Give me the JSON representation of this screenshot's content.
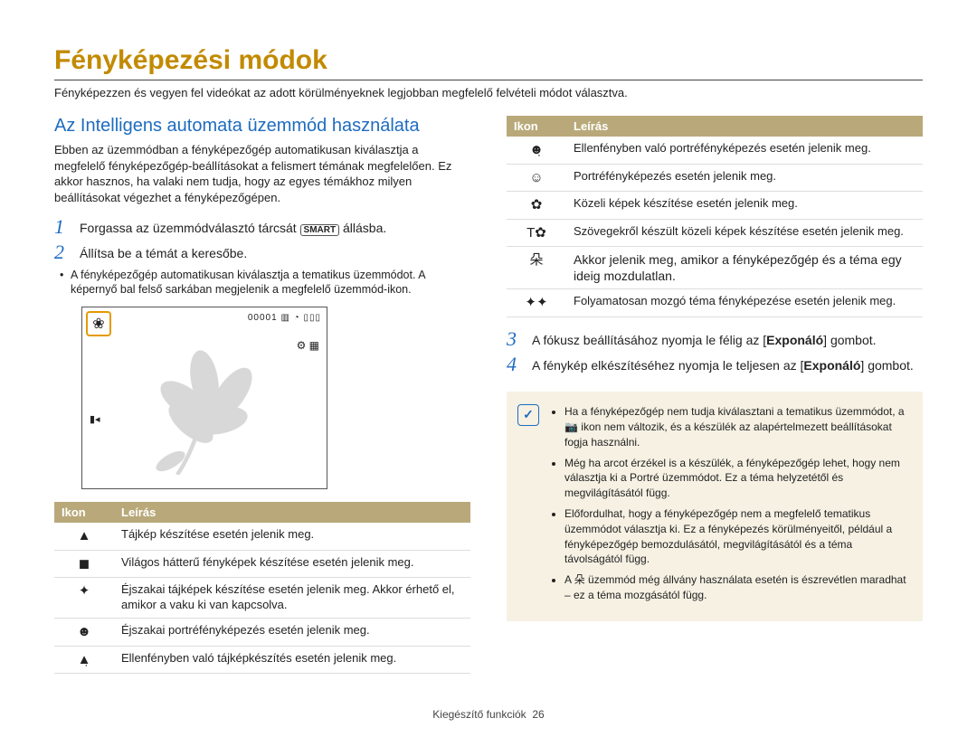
{
  "title": "Fényképezési módok",
  "subtitle": "Fényképezzen és vegyen fel videókat az adott körülményeknek legjobban megfelelő felvételi módot választva.",
  "section_heading": "Az Intelligens automata üzemmód használata",
  "intro": "Ebben az üzemmódban a fényképezőgép automatikusan kiválasztja a megfelelő fényképezőgép-beállításokat a felismert témának megfelelően. Ez akkor hasznos, ha valaki nem tudja, hogy az egyes témákhoz milyen beállításokat végezhet a fényképezőgépen.",
  "steps": {
    "1": {
      "pre": "Forgassa az üzemmódválasztó tárcsát ",
      "dial": "SMART",
      "post": " állásba."
    },
    "2": {
      "text": "Állítsa be a témát a keresőbe.",
      "bullet": "A fényképezőgép automatikusan kiválasztja a tematikus üzemmódot. A képernyő bal felső sarkában megjelenik a megfelelő üzemmód-ikon."
    },
    "3": {
      "pre": "A fókusz beállításához nyomja le félig az [",
      "bold": "Exponáló",
      "post": "] gombot."
    },
    "4": {
      "pre": "A fénykép elkészítéséhez nyomja le teljesen az [",
      "bold": "Exponáló",
      "post": "] gombot."
    }
  },
  "screenshot": {
    "badge_glyph": "❀",
    "counter": "00001",
    "top_glyphs": "▥ ◔ ▯▯▯",
    "right_glyphs": "⚙\n▦",
    "left_glyphs": "▮◂"
  },
  "table_headers": {
    "icon": "Ikon",
    "desc": "Leírás"
  },
  "left_table": [
    {
      "glyph": "▲",
      "desc": "Tájkép készítése esetén jelenik meg."
    },
    {
      "glyph": "◼",
      "desc": "Világos hátterű fényképek készítése esetén jelenik meg."
    },
    {
      "glyph": "✦",
      "desc": "Éjszakai tájképek készítése esetén jelenik meg. Akkor érhető el, amikor a vaku ki van kapcsolva."
    },
    {
      "glyph": "☻",
      "desc": "Éjszakai portréfényképezés esetén jelenik meg."
    },
    {
      "glyph": "▲̣",
      "desc": "Ellenfényben való tájképkészítés esetén jelenik meg."
    }
  ],
  "right_table": [
    {
      "glyph": "☻̣",
      "desc": "Ellenfényben való portréfényképezés esetén jelenik meg."
    },
    {
      "glyph": "☺",
      "desc": "Portréfényképezés esetén jelenik meg."
    },
    {
      "glyph": "✿",
      "desc": "Közeli képek készítése esetén jelenik meg."
    },
    {
      "glyph": "T✿",
      "desc": "Szövegekről készült közeli képek készítése esetén jelenik meg."
    },
    {
      "glyph": "朵",
      "desc": "Akkor jelenik meg, amikor a fényképezőgép és a téma egy ideig mozdulatlan."
    },
    {
      "glyph": "✦✦",
      "desc": "Folyamatosan mozgó téma fényképezése esetén jelenik meg."
    }
  ],
  "note_items": [
    {
      "pre": "Ha a fényképezőgép nem tudja kiválasztani a tematikus üzemmódot, a ",
      "glyph": "📷",
      "post": " ikon nem változik, és a készülék az alapértelmezett beállításokat fogja használni."
    },
    {
      "text": "Még ha arcot érzékel is a készülék, a fényképezőgép lehet, hogy nem választja ki a Portré üzemmódot. Ez a téma helyzetétől és megvilágításától függ."
    },
    {
      "text": "Előfordulhat, hogy a fényképezőgép nem a megfelelő tematikus üzemmódot választja ki. Ez a fényképezés körülményeitől, például a fényképezőgép bemozdulásától, megvilágításától és a téma távolságától függ."
    },
    {
      "pre": "A ",
      "glyph": "朵",
      "post": " üzemmód még állvány használata esetén is észrevétlen maradhat – ez a téma mozgásától függ."
    }
  ],
  "footer": {
    "label": "Kiegészítő funkciók",
    "page": "26"
  }
}
